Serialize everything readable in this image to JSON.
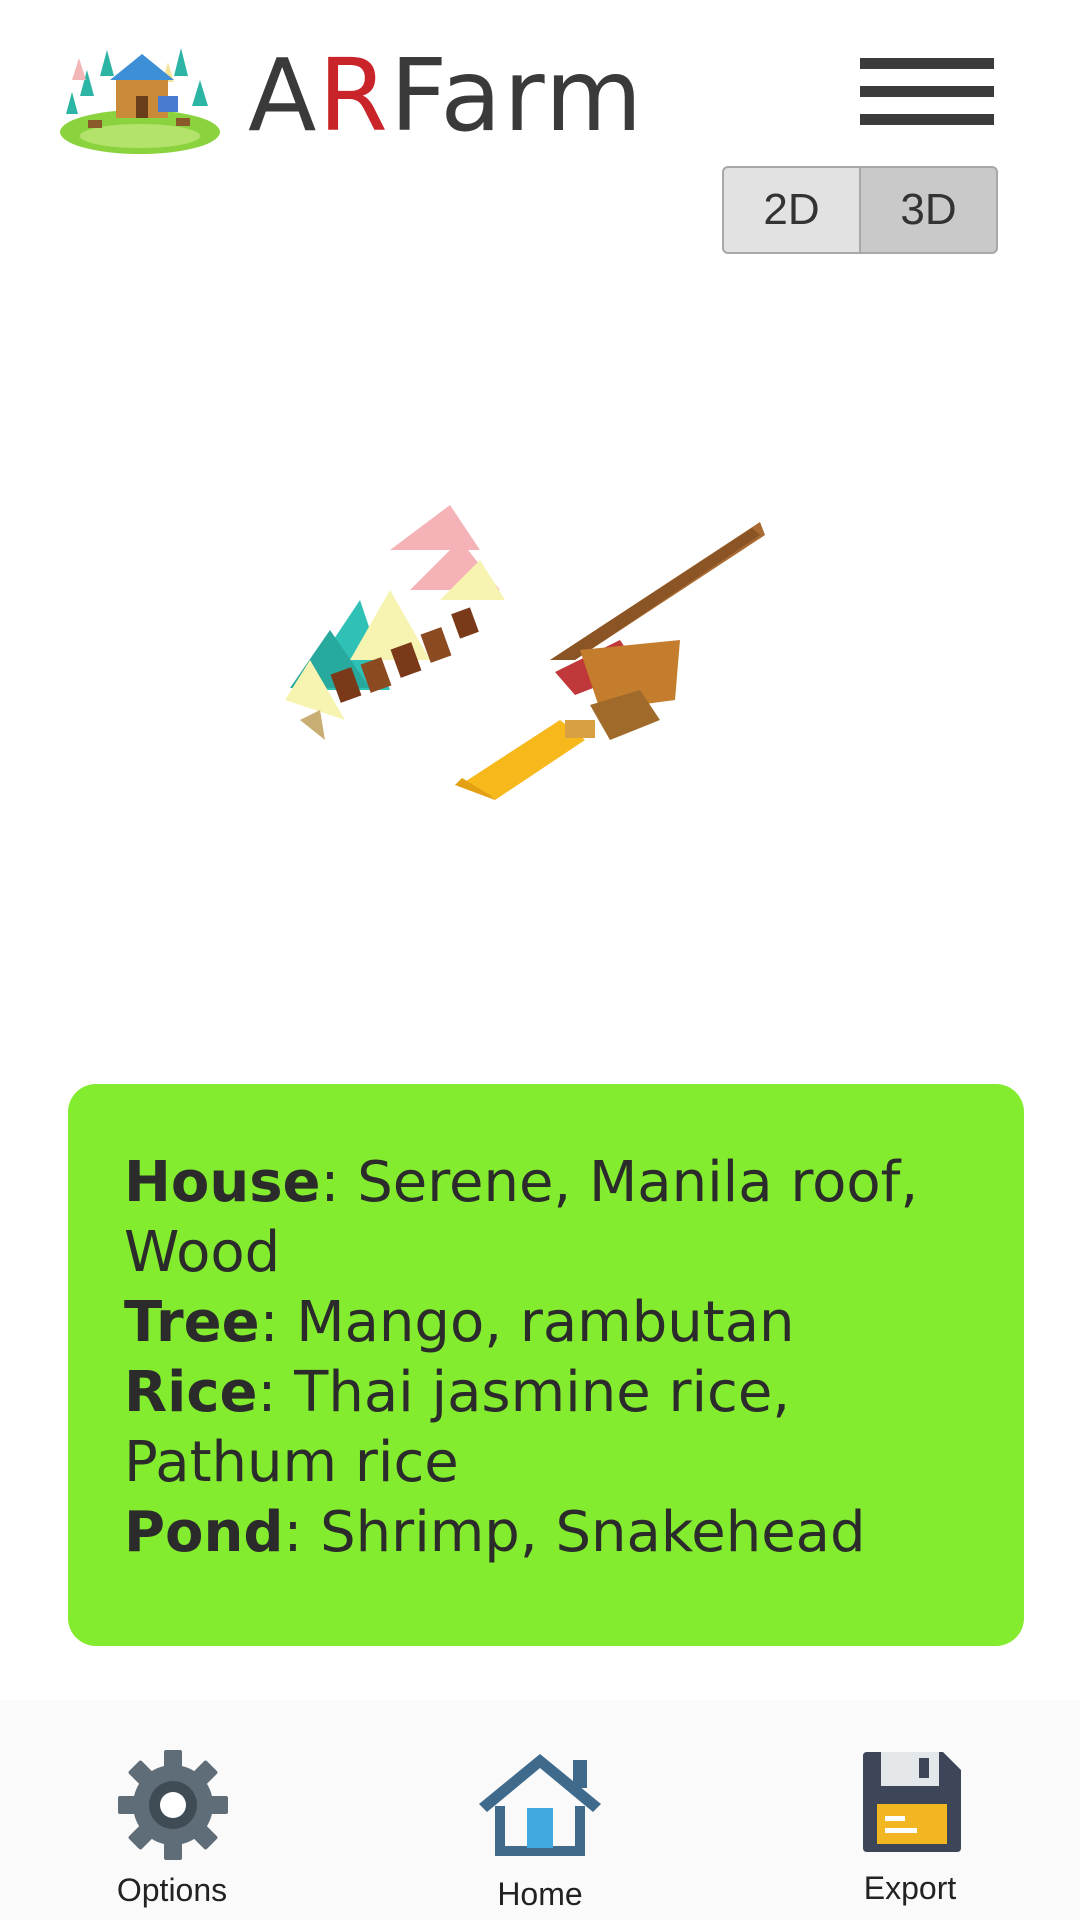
{
  "app": {
    "logo_prefix": "A",
    "logo_accent": "R",
    "logo_suffix": "Farm",
    "accent_color": "#c8242a"
  },
  "view_toggle": {
    "options": [
      "2D",
      "3D"
    ],
    "selected": "3D"
  },
  "info": {
    "house_label": "House",
    "house_value": ": Serene, Manila roof,",
    "house_value_cont": "Wood",
    "tree_label": "Tree",
    "tree_value": ": Mango, rambutan",
    "rice_label": "Rice",
    "rice_value": ": Thai jasmine rice,",
    "rice_value_cont": "Pathum rice",
    "pond_label": "Pond",
    "pond_value": ": Shrimp, Snakehead",
    "card_color": "#84ec2e"
  },
  "nav": {
    "options_label": "Options",
    "home_label": "Home",
    "export_label": "Export"
  },
  "icons": {
    "menu": "hamburger-menu-icon",
    "options": "gear-icon",
    "home": "house-icon",
    "export": "floppy-disk-icon"
  }
}
